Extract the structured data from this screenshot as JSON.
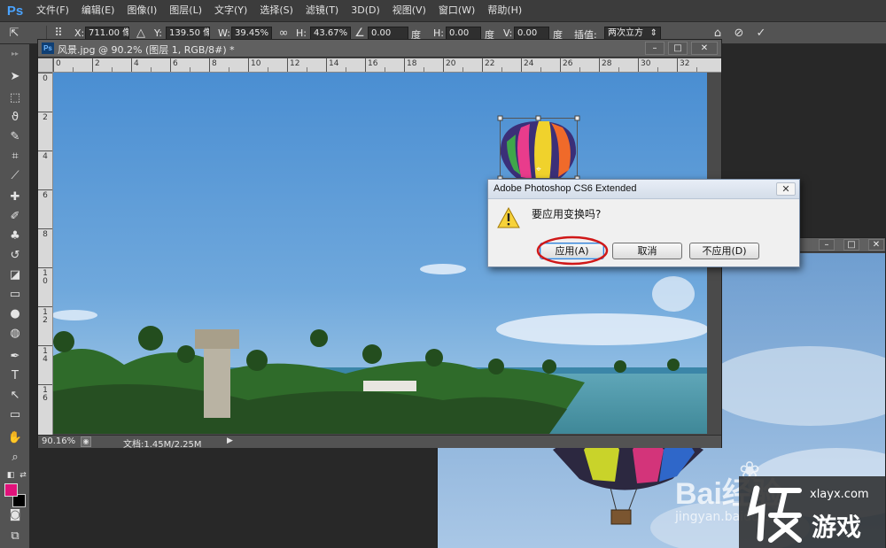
{
  "app": {
    "logo": "Ps"
  },
  "menu": [
    "文件(F)",
    "编辑(E)",
    "图像(I)",
    "图层(L)",
    "文字(Y)",
    "选择(S)",
    "滤镜(T)",
    "3D(D)",
    "视图(V)",
    "窗口(W)",
    "帮助(H)"
  ],
  "options": {
    "x_label": "X:",
    "x_value": "711.00 像",
    "y_label": "Y:",
    "y_value": "139.50 像",
    "w_label": "W:",
    "w_value": "39.45%",
    "h_label": "H:",
    "h_value": "43.67%",
    "angle_value": "0.00",
    "angle_unit": "度",
    "hskew_label": "H:",
    "hskew_value": "0.00",
    "hskew_unit": "度",
    "vskew_label": "V:",
    "vskew_value": "0.00",
    "vskew_unit": "度",
    "interp_label": "插值:",
    "interp_value": "两次立方"
  },
  "document": {
    "title": "风景.jpg @ 90.2% (图层 1, RGB/8#) *",
    "ruler_top": [
      "0",
      "2",
      "4",
      "6",
      "8",
      "10",
      "12",
      "14",
      "16",
      "18",
      "20",
      "22",
      "24",
      "26",
      "28",
      "30",
      "32"
    ],
    "ruler_left": [
      "0",
      "2",
      "4",
      "6",
      "8",
      "10",
      "12",
      "14",
      "16"
    ],
    "zoom": "90.16%",
    "doc_info": "文档:1.45M/2.25M"
  },
  "dialog": {
    "title": "Adobe Photoshop CS6 Extended",
    "message": "要应用变换吗?",
    "apply": "应用(A)",
    "cancel": "取消",
    "dont_apply": "不应用(D)"
  },
  "watermark": {
    "baidu_text": "Bai经验",
    "url": "jingyan.baidu.com",
    "site": "xlayx.com",
    "brand": "游戏"
  },
  "colors": {
    "foreground": "#e0127a",
    "background": "#000000",
    "dialog_highlight": "#d01818"
  }
}
